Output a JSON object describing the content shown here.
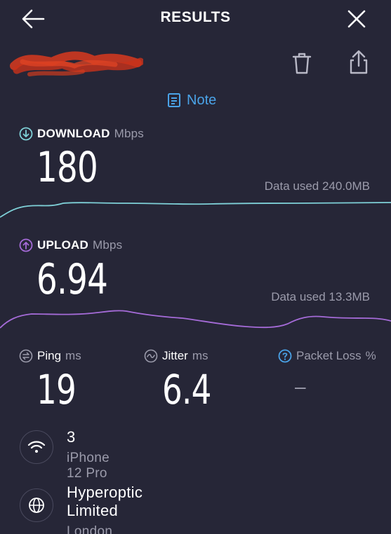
{
  "header": {
    "title": "RESULTS"
  },
  "note": {
    "label": "Note"
  },
  "download": {
    "label": "DOWNLOAD",
    "unit": "Mbps",
    "value": "180",
    "data_used": "Data used 240.0MB",
    "color": "#7fd1d8"
  },
  "upload": {
    "label": "UPLOAD",
    "unit": "Mbps",
    "value": "6.94",
    "data_used": "Data used 13.3MB",
    "color": "#a56bd8"
  },
  "ping": {
    "label": "Ping",
    "unit": "ms",
    "value": "19"
  },
  "jitter": {
    "label": "Jitter",
    "unit": "ms",
    "value": "6.4"
  },
  "packet_loss": {
    "label": "Packet Loss",
    "unit": "%",
    "value": "–",
    "color": "#4aa3e8"
  },
  "connection": {
    "network": "3",
    "device": "iPhone 12 Pro"
  },
  "provider": {
    "name": "Hyperoptic Limited",
    "location": "London"
  }
}
